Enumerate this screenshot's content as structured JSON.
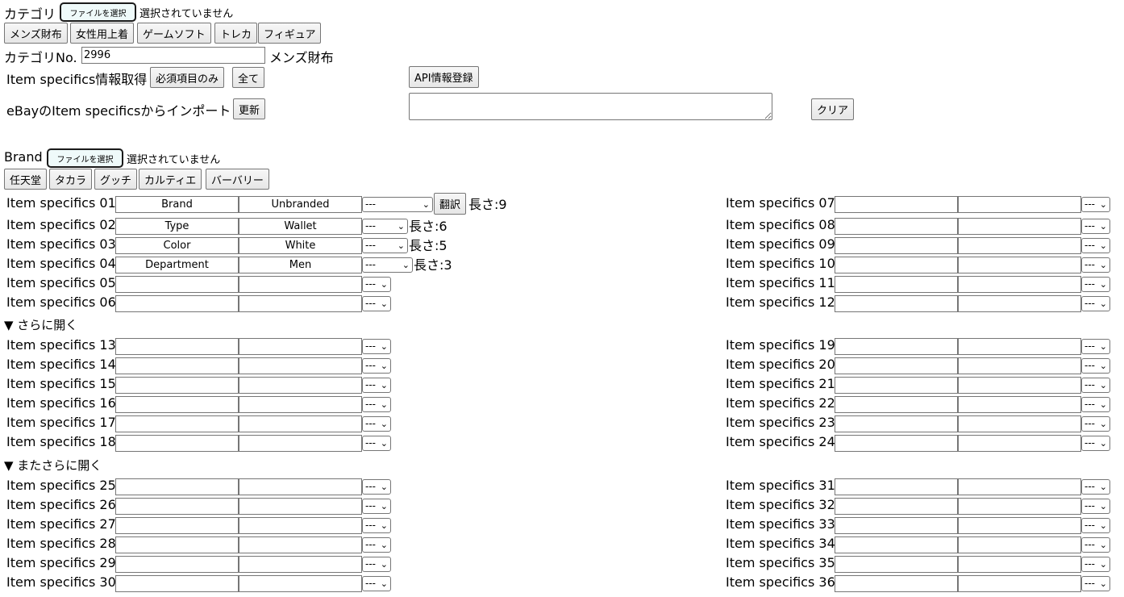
{
  "category": {
    "label": "カテゴリ",
    "file_button": "ファイルを選択",
    "file_status": "選択されていません",
    "presets": [
      "メンズ財布",
      "女性用上着",
      "ゲームソフト",
      "トレカ",
      "フィギュア"
    ],
    "no_label": "カテゴリNo.",
    "no_value": "2996",
    "name": "メンズ財布"
  },
  "specifics_fetch": {
    "label": "Item specifics情報取得",
    "required_button": "必須項目のみ",
    "all_button": "全て",
    "api_button": "API情報登録"
  },
  "import": {
    "label": "eBayのItem specificsからインポート",
    "update_button": "更新",
    "clear_button": "クリア"
  },
  "brand": {
    "label": "Brand",
    "file_button": "ファイルを選択",
    "file_status": "選択されていません",
    "presets": [
      "任天堂",
      "タカラ",
      "グッチ",
      "カルティエ",
      "バーバリー"
    ]
  },
  "translate_button": "翻訳",
  "select_default": "---",
  "expand": {
    "more": "▼ さらに開く",
    "even_more": "▼ またさらに開く"
  },
  "specifics": [
    {
      "label": "Item specifics 01",
      "name": "Brand",
      "value": "Unbranded",
      "length": "長さ:9"
    },
    {
      "label": "Item specifics 02",
      "name": "Type",
      "value": "Wallet",
      "length": "長さ:6"
    },
    {
      "label": "Item specifics 03",
      "name": "Color",
      "value": "White",
      "length": "長さ:5"
    },
    {
      "label": "Item specifics 04",
      "name": "Department",
      "value": "Men",
      "length": "長さ:3"
    },
    {
      "label": "Item specifics 05",
      "name": "",
      "value": "",
      "length": ""
    },
    {
      "label": "Item specifics 06",
      "name": "",
      "value": "",
      "length": ""
    },
    {
      "label": "Item specifics 07",
      "name": "",
      "value": "",
      "length": ""
    },
    {
      "label": "Item specifics 08",
      "name": "",
      "value": "",
      "length": ""
    },
    {
      "label": "Item specifics 09",
      "name": "",
      "value": "",
      "length": ""
    },
    {
      "label": "Item specifics 10",
      "name": "",
      "value": "",
      "length": ""
    },
    {
      "label": "Item specifics 11",
      "name": "",
      "value": "",
      "length": ""
    },
    {
      "label": "Item specifics 12",
      "name": "",
      "value": "",
      "length": ""
    },
    {
      "label": "Item specifics 13",
      "name": "",
      "value": "",
      "length": ""
    },
    {
      "label": "Item specifics 14",
      "name": "",
      "value": "",
      "length": ""
    },
    {
      "label": "Item specifics 15",
      "name": "",
      "value": "",
      "length": ""
    },
    {
      "label": "Item specifics 16",
      "name": "",
      "value": "",
      "length": ""
    },
    {
      "label": "Item specifics 17",
      "name": "",
      "value": "",
      "length": ""
    },
    {
      "label": "Item specifics 18",
      "name": "",
      "value": "",
      "length": ""
    },
    {
      "label": "Item specifics 19",
      "name": "",
      "value": "",
      "length": ""
    },
    {
      "label": "Item specifics 20",
      "name": "",
      "value": "",
      "length": ""
    },
    {
      "label": "Item specifics 21",
      "name": "",
      "value": "",
      "length": ""
    },
    {
      "label": "Item specifics 22",
      "name": "",
      "value": "",
      "length": ""
    },
    {
      "label": "Item specifics 23",
      "name": "",
      "value": "",
      "length": ""
    },
    {
      "label": "Item specifics 24",
      "name": "",
      "value": "",
      "length": ""
    },
    {
      "label": "Item specifics 25",
      "name": "",
      "value": "",
      "length": ""
    },
    {
      "label": "Item specifics 26",
      "name": "",
      "value": "",
      "length": ""
    },
    {
      "label": "Item specifics 27",
      "name": "",
      "value": "",
      "length": ""
    },
    {
      "label": "Item specifics 28",
      "name": "",
      "value": "",
      "length": ""
    },
    {
      "label": "Item specifics 29",
      "name": "",
      "value": "",
      "length": ""
    },
    {
      "label": "Item specifics 30",
      "name": "",
      "value": "",
      "length": ""
    },
    {
      "label": "Item specifics 31",
      "name": "",
      "value": "",
      "length": ""
    },
    {
      "label": "Item specifics 32",
      "name": "",
      "value": "",
      "length": ""
    },
    {
      "label": "Item specifics 33",
      "name": "",
      "value": "",
      "length": ""
    },
    {
      "label": "Item specifics 34",
      "name": "",
      "value": "",
      "length": ""
    },
    {
      "label": "Item specifics 35",
      "name": "",
      "value": "",
      "length": ""
    },
    {
      "label": "Item specifics 36",
      "name": "",
      "value": "",
      "length": ""
    }
  ]
}
